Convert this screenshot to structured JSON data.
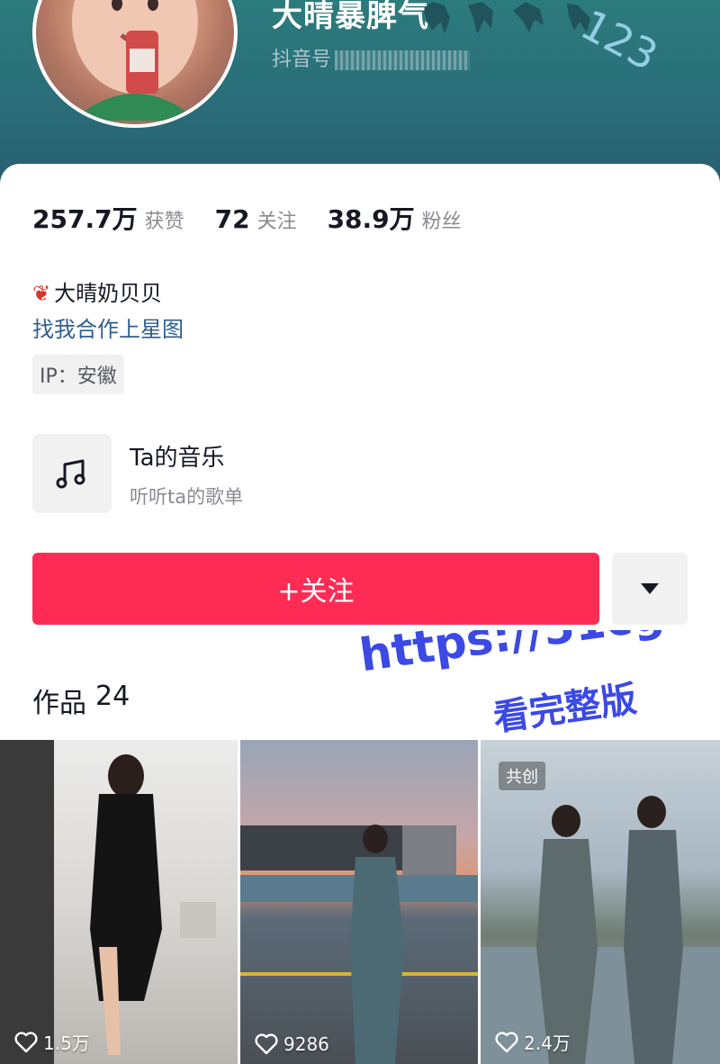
{
  "profile": {
    "nickname": "大晴暴脾气",
    "douyin_id_prefix": "抖音号",
    "header_deco": "123"
  },
  "stats": [
    {
      "value": "257.7万",
      "label": "获赞"
    },
    {
      "value": "72",
      "label": "关注"
    },
    {
      "value": "38.9万",
      "label": "粉丝"
    }
  ],
  "bio": {
    "name_line": "大晴奶贝贝",
    "link_line": "找我合作上星图",
    "ip": "IP：安徽"
  },
  "music": {
    "title": "Ta的音乐",
    "subtitle": "听听ta的歌单",
    "icon": "music-note-icon"
  },
  "actions": {
    "follow_label": "+关注",
    "more_icon": "caret-down-icon"
  },
  "works": {
    "label": "作品",
    "count": "24",
    "items": [
      {
        "likes": "1.5万",
        "tag": ""
      },
      {
        "likes": "9286",
        "tag": ""
      },
      {
        "likes": "2.4万",
        "tag": "共创"
      }
    ]
  },
  "watermark": {
    "url": "https://51cg02.cc",
    "text": "看完整版"
  },
  "colors": {
    "accent": "#fe2c55",
    "link": "#2f5e90",
    "header": "#2a6f7a",
    "watermark": "#3b49e5"
  }
}
